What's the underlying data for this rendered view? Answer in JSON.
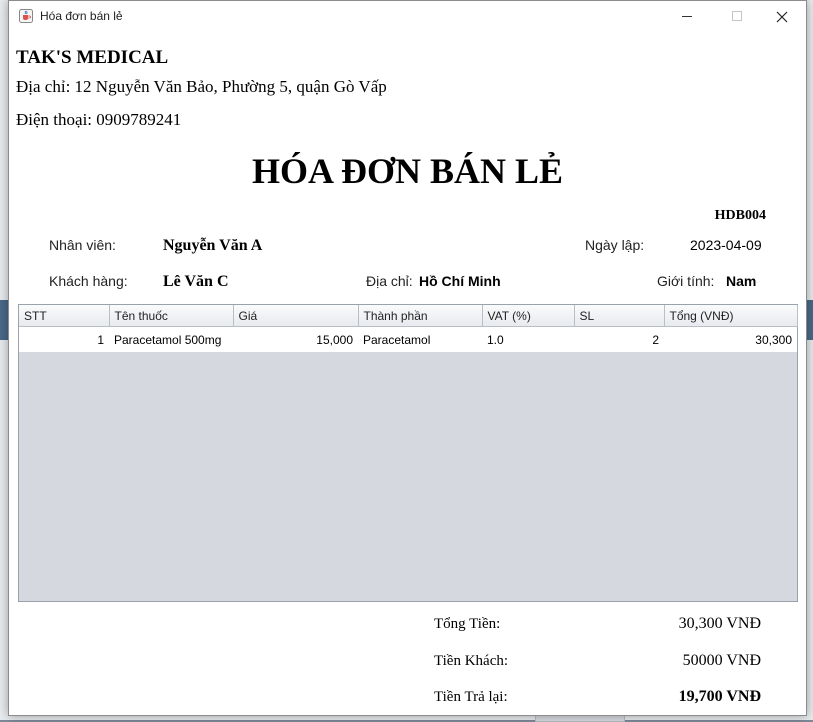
{
  "window": {
    "title": "Hóa đơn bán lẻ",
    "app_icon": "java-cup-icon"
  },
  "shop": {
    "name": "TAK'S MEDICAL",
    "address": "Địa chỉ: 12 Nguyễn Văn Bảo, Phường 5, quận Gò Vấp",
    "phone": "Điện thoại: 0909789241"
  },
  "invoice": {
    "title": "HÓA ĐƠN BÁN LẺ",
    "code": "HDB004",
    "employee_label": "Nhân viên:",
    "employee": "Nguyễn Văn A",
    "date_label": "Ngày lập:",
    "date": "2023-04-09",
    "customer_label": "Khách hàng:",
    "customer": "Lê Văn C",
    "address_label": "Địa chỉ:",
    "address": "Hồ Chí Minh",
    "gender_label": "Giới tính:",
    "gender": "Nam"
  },
  "table": {
    "columns": [
      "STT",
      "Tên thuốc",
      "Giá",
      "Thành phần",
      "VAT (%)",
      "SL",
      "Tổng (VNĐ)"
    ],
    "rows": [
      [
        "1",
        "Paracetamol 500mg",
        "15,000",
        "Paracetamol",
        "1.0",
        "2",
        "30,300"
      ]
    ]
  },
  "summary": {
    "total_label": "Tổng Tiền:",
    "total": "30,300 VNĐ",
    "paid_label": "Tiền Khách:",
    "paid": "50000 VNĐ",
    "change_label": "Tiền Trả lại:",
    "change": "19,700 VNĐ"
  },
  "colors": {
    "grid_empty": "#d5d9df",
    "header_bg": "#e7eaee"
  }
}
